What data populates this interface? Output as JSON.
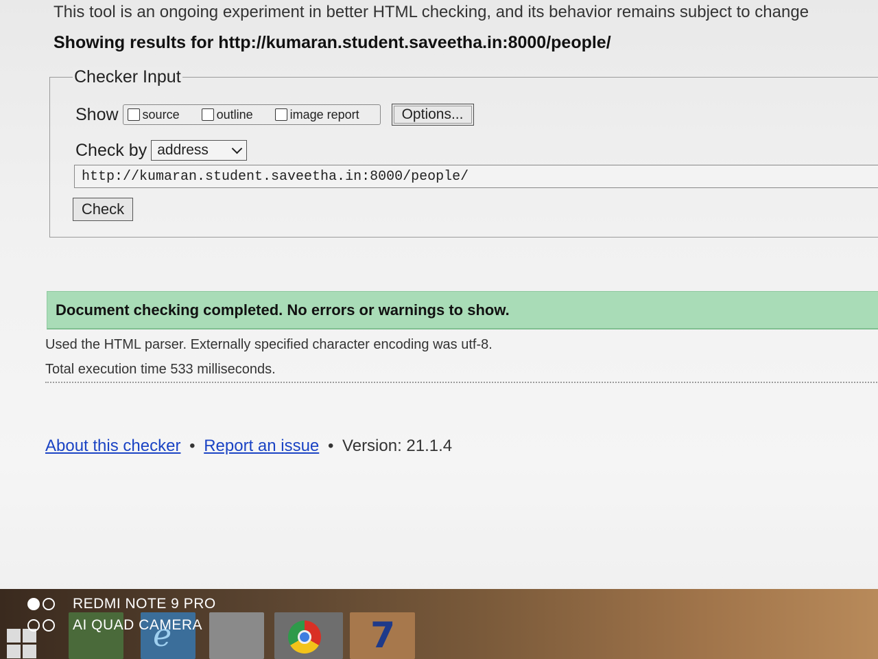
{
  "notice": "This tool is an ongoing experiment in better HTML checking, and its behavior remains subject to change",
  "showing": "Showing results for http://kumaran.student.saveetha.in:8000/people/",
  "checker_input": {
    "legend": "Checker Input",
    "show_label": "Show",
    "options": [
      {
        "label": "source",
        "checked": false
      },
      {
        "label": "outline",
        "checked": false
      },
      {
        "label": "image report",
        "checked": false
      }
    ],
    "options_button": "Options...",
    "check_by_label": "Check by",
    "check_by_value": "address",
    "url_value": "http://kumaran.student.saveetha.in:8000/people/",
    "check_button": "Check"
  },
  "result": {
    "message": "Document checking completed. No errors or warnings to show.",
    "parser_info": "Used the HTML parser. Externally specified character encoding was utf-8.",
    "execution_time": "Total execution time 533 milliseconds."
  },
  "footer": {
    "about_link": "About this checker",
    "separator": "•",
    "report_link": "Report an issue",
    "version": "Version: 21.1.4"
  },
  "watermark": {
    "line1": "REDMI NOTE 9 PRO",
    "line2": "AI QUAD CAMERA"
  },
  "taskbar": {
    "icons": [
      "windows-start-icon",
      "file-manager-icon",
      "internet-explorer-icon",
      "notepad-icon",
      "chrome-icon",
      "app-seven-icon"
    ]
  }
}
